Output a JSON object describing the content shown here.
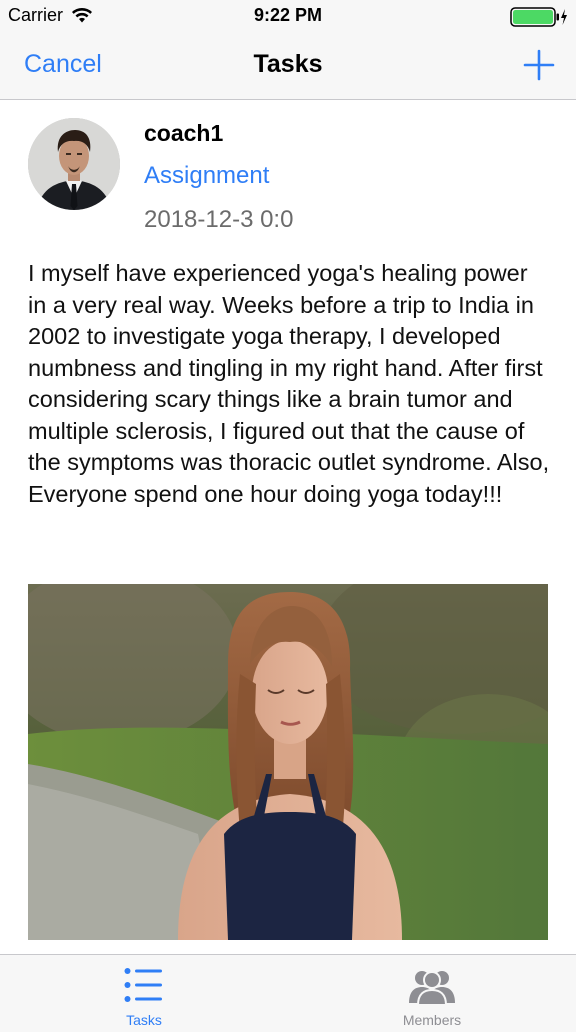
{
  "status_bar": {
    "carrier": "Carrier",
    "time": "9:22 PM",
    "wifi_icon": "wifi-icon",
    "battery_icon": "battery-charging-icon",
    "battery_color": "#4cd964"
  },
  "nav": {
    "cancel_label": "Cancel",
    "title": "Tasks",
    "add_icon": "plus-icon",
    "accent_color": "#2f7ef6"
  },
  "post": {
    "author": "coach1",
    "category": "Assignment",
    "date": "2018-12-3 0:0",
    "body": "I myself have experienced yoga's healing power in a very real way. Weeks before a trip to India in 2002 to investigate yoga therapy, I developed numbness and tingling in my right hand. After first considering scary things like a brain tumor and multiple sclerosis, I figured out that the cause of the symptoms was thoracic outlet syndrome. Also, Everyone spend one hour doing yoga today!!!"
  },
  "tab_bar": {
    "tabs": [
      {
        "label": "Tasks",
        "icon": "list-icon",
        "active": true
      },
      {
        "label": "Members",
        "icon": "people-icon",
        "active": false
      }
    ]
  }
}
